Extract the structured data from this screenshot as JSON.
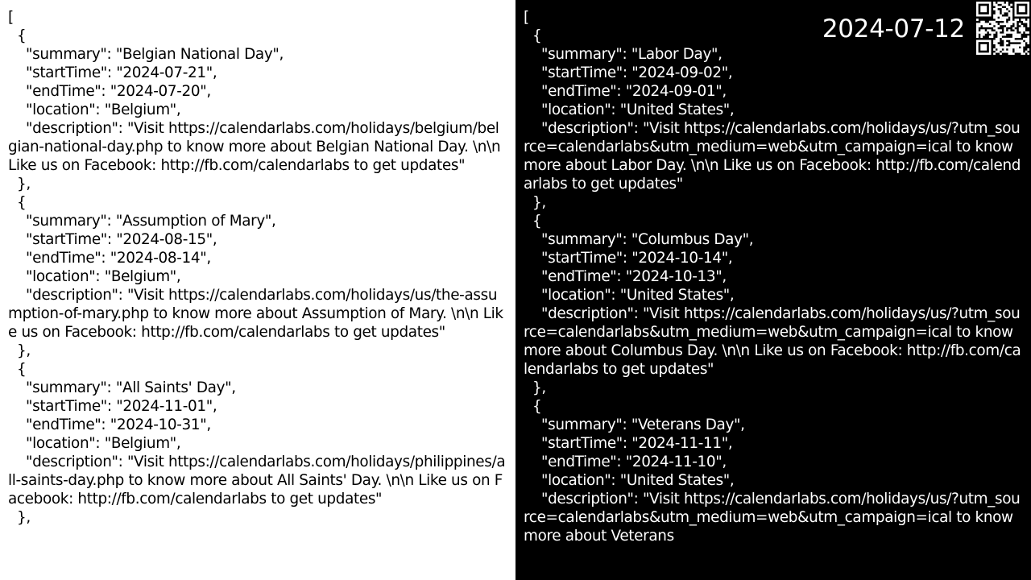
{
  "left_panel": {
    "json_text": "[\n  {\n    \"summary\": \"Belgian National Day\",\n    \"startTime\": \"2024-07-21\",\n    \"endTime\": \"2024-07-20\",\n    \"location\": \"Belgium\",\n    \"description\": \"Visit https://calendarlabs.com/holidays/belgium/belgian-national-day.php to know more about Belgian National Day. \\n\\n Like us on Facebook: http://fb.com/calendarlabs to get updates\"\n  },\n  {\n    \"summary\": \"Assumption of Mary\",\n    \"startTime\": \"2024-08-15\",\n    \"endTime\": \"2024-08-14\",\n    \"location\": \"Belgium\",\n    \"description\": \"Visit https://calendarlabs.com/holidays/us/the-assumption-of-mary.php to know more about Assumption of Mary. \\n\\n Like us on Facebook: http://fb.com/calendarlabs to get updates\"\n  },\n  {\n    \"summary\": \"All Saints' Day\",\n    \"startTime\": \"2024-11-01\",\n    \"endTime\": \"2024-10-31\",\n    \"location\": \"Belgium\",\n    \"description\": \"Visit https://calendarlabs.com/holidays/philippines/all-saints-day.php to know more about All Saints' Day. \\n\\n Like us on Facebook: http://fb.com/calendarlabs to get updates\"\n  },"
  },
  "right_panel": {
    "date": "2024-07-12",
    "qr_icon": "qr-code-icon",
    "json_text": "[\n  {\n    \"summary\": \"Labor Day\",\n    \"startTime\": \"2024-09-02\",\n    \"endTime\": \"2024-09-01\",\n    \"location\": \"United States\",\n    \"description\": \"Visit https://calendarlabs.com/holidays/us/?utm_source=calendarlabs&utm_medium=web&utm_campaign=ical to know more about Labor Day. \\n\\n Like us on Facebook: http://fb.com/calendarlabs to get updates\"\n  },\n  {\n    \"summary\": \"Columbus Day\",\n    \"startTime\": \"2024-10-14\",\n    \"endTime\": \"2024-10-13\",\n    \"location\": \"United States\",\n    \"description\": \"Visit https://calendarlabs.com/holidays/us/?utm_source=calendarlabs&utm_medium=web&utm_campaign=ical to know more about Columbus Day. \\n\\n Like us on Facebook: http://fb.com/calendarlabs to get updates\"\n  },\n  {\n    \"summary\": \"Veterans Day\",\n    \"startTime\": \"2024-11-11\",\n    \"endTime\": \"2024-11-10\",\n    \"location\": \"United States\",\n    \"description\": \"Visit https://calendarlabs.com/holidays/us/?utm_source=calendarlabs&utm_medium=web&utm_campaign=ical to know more about Veterans"
  },
  "colors": {
    "left_background": "#ffffff",
    "left_text": "#000000",
    "right_background": "#000000",
    "right_text": "#ffffff"
  }
}
